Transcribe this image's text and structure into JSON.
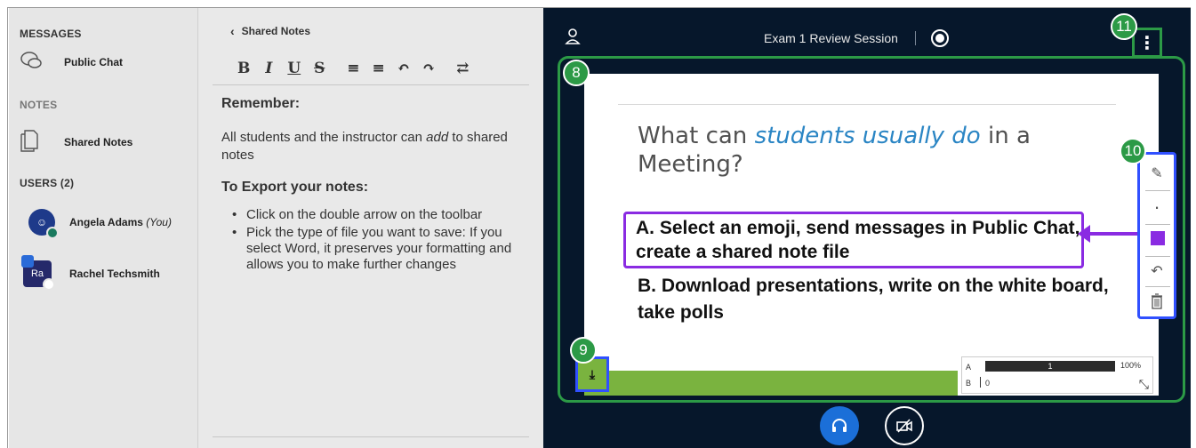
{
  "sidebar": {
    "messages_title": "MESSAGES",
    "public_chat": "Public Chat",
    "notes_title": "NOTES",
    "shared_notes": "Shared Notes",
    "users_title": "USERS (2)",
    "users": [
      {
        "name": "Angela Adams",
        "tag": "(You)",
        "initials": ""
      },
      {
        "name": "Rachel Techsmith",
        "tag": "",
        "initials": "Ra"
      }
    ]
  },
  "notes": {
    "back_label": "Shared Notes",
    "toolbar": {
      "bold": "B",
      "italic": "I",
      "underline": "U",
      "strike": "S",
      "ordered_list": "≡",
      "bullet_list": "≡",
      "undo": "↶",
      "redo": "↷",
      "export": "⇄"
    },
    "heading": "Remember:",
    "paragraph_pre": "All students and the instructor can ",
    "paragraph_em": "add",
    "paragraph_post": " to shared notes",
    "export_heading": "To Export your notes:",
    "bullets": [
      "Click on the double arrow on the toolbar",
      "Pick the type of file you want to save: If you select Word, it preserves your formatting and allows you to make further changes"
    ]
  },
  "presentation": {
    "session_title": "Exam 1 Review Session",
    "slide": {
      "title_pre": "What can ",
      "title_highlight": "students usually do",
      "title_post": " in a Meeting?",
      "option_a": "A. Select an emoji, send messages in Public Chat, create a shared note file",
      "option_b": "B. Download presentations, write on the white board, take polls"
    },
    "poll": {
      "a_label": "A",
      "a_count": "1",
      "a_percent": "100%",
      "b_label": "B",
      "b_count": "0",
      "a_fraction": 1.0
    },
    "callouts": [
      "8",
      "9",
      "10",
      "11"
    ],
    "colors": {
      "accent_green": "#2c9a46",
      "highlight_purple": "#8a2be2",
      "callout_blue": "#3050ff",
      "background": "#06172b"
    }
  }
}
